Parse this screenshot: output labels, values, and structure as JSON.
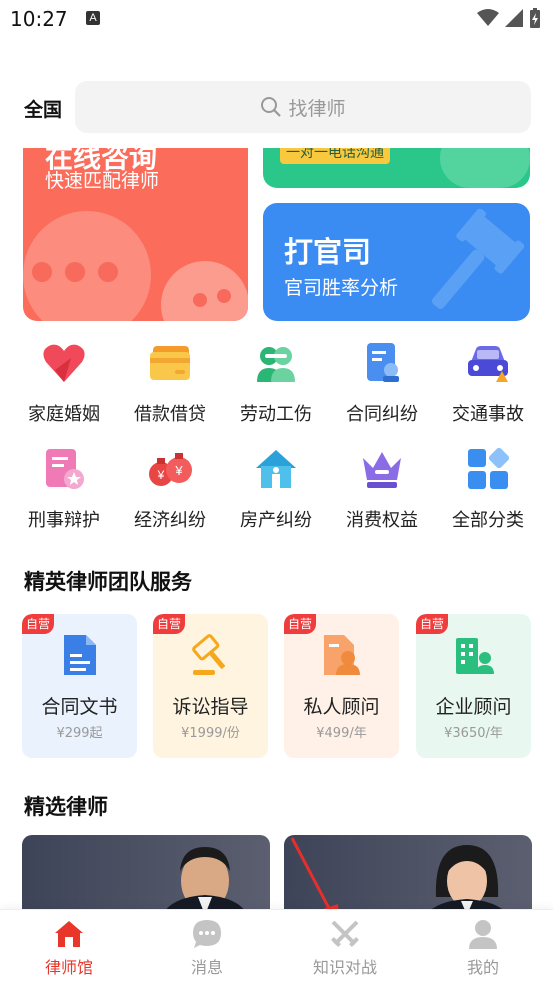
{
  "status_bar": {
    "time": "10:27",
    "badge": "A"
  },
  "header": {
    "location": "全国",
    "search_placeholder": "找律师"
  },
  "banners": {
    "left": {
      "title": "在线咨询",
      "subtitle": "快速匹配律师"
    },
    "top_right": {
      "tag": "一对一电话沟通"
    },
    "bottom_right": {
      "title": "打官司",
      "subtitle": "官司胜率分析"
    }
  },
  "categories": [
    {
      "label": "家庭婚姻",
      "icon": "heart-icon"
    },
    {
      "label": "借款借贷",
      "icon": "card-icon"
    },
    {
      "label": "劳动工伤",
      "icon": "worker-icon"
    },
    {
      "label": "合同纠纷",
      "icon": "contract-icon"
    },
    {
      "label": "交通事故",
      "icon": "car-icon"
    },
    {
      "label": "刑事辩护",
      "icon": "criminal-doc-icon"
    },
    {
      "label": "经济纠纷",
      "icon": "money-bag-icon"
    },
    {
      "label": "房产纠纷",
      "icon": "house-icon"
    },
    {
      "label": "消费权益",
      "icon": "crown-icon"
    },
    {
      "label": "全部分类",
      "icon": "grid-icon"
    }
  ],
  "elite_section": {
    "title": "精英律师团队服务",
    "badge": "自营",
    "cards": [
      {
        "name": "合同文书",
        "price": "¥299起",
        "bg": "#eaf2fe",
        "icon": "document-icon"
      },
      {
        "name": "诉讼指导",
        "price": "¥1999/份",
        "bg": "#fff4e0",
        "icon": "gavel-icon"
      },
      {
        "name": "私人顾问",
        "price": "¥499/年",
        "bg": "#fff1e8",
        "icon": "person-doc-icon"
      },
      {
        "name": "企业顾问",
        "price": "¥3650/年",
        "bg": "#e8f8f1",
        "icon": "building-icon"
      }
    ]
  },
  "lawyers_section": {
    "title": "精选律师"
  },
  "bottom_nav": [
    {
      "label": "律师馆",
      "icon": "home-icon",
      "active": true
    },
    {
      "label": "消息",
      "icon": "chat-icon",
      "active": false
    },
    {
      "label": "知识对战",
      "icon": "swords-icon",
      "active": false
    },
    {
      "label": "我的",
      "icon": "user-icon",
      "active": false
    }
  ],
  "colors": {
    "accent": "#e8362b",
    "banner_red": "#fb6c5b",
    "banner_green": "#2bc78a",
    "banner_blue": "#3a8cf2"
  }
}
